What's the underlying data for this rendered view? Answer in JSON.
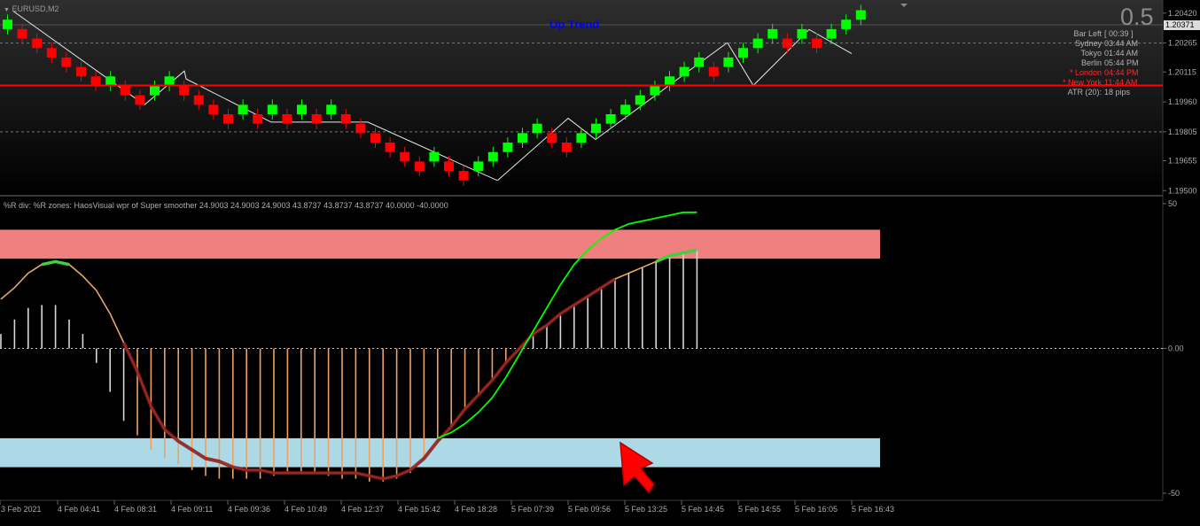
{
  "main_chart": {
    "symbol_title": "EURUSD,M2",
    "trend_label": "Up Trend",
    "top_value": "0.5",
    "current_price": "1.20371",
    "price_axis": [
      "1.20420",
      "1.20265",
      "1.20115",
      "1.19960",
      "1.19805",
      "1.19655",
      "1.19500"
    ],
    "info_panel": [
      {
        "key": "Bar Left",
        "value": "[ 00:39 ]",
        "color": "#b4b4b4"
      },
      {
        "key": "Sydney",
        "value": "03:44 AM",
        "color": "#b4b4b4"
      },
      {
        "key": "Tokyo",
        "value": "01:44 AM",
        "color": "#b4b4b4"
      },
      {
        "key": "Berlin",
        "value": "05:44 PM",
        "color": "#b4b4b4"
      },
      {
        "key": "* London",
        "value": "04:44 PM",
        "color": "#ff2a2a"
      },
      {
        "key": "* New York",
        "value": "11:44 AM",
        "color": "#ff2a2a"
      },
      {
        "key": "ATR (20):",
        "value": "18 pips",
        "color": "#b4b4b4"
      }
    ]
  },
  "indicator": {
    "title": "%R div: %R zones:  HaosVisual wpr of Super smoother 24.9003 24.9003 24.9003 43.8737 43.8737 43.8737 40.0000 -40.0000",
    "axis": [
      "50",
      "0.00",
      "-50"
    ]
  },
  "time_axis": [
    "3 Feb 2021",
    "4 Feb 04:41",
    "4 Feb 08:31",
    "4 Feb 09:11",
    "4 Feb 09:36",
    "4 Feb 10:49",
    "4 Feb 12:37",
    "4 Feb 15:42",
    "4 Feb 18:28",
    "5 Feb 07:39",
    "5 Feb 09:56",
    "5 Feb 13:25",
    "5 Feb 14:45",
    "5 Feb 14:55",
    "5 Feb 16:05",
    "5 Feb 16:43"
  ],
  "colors": {
    "up_brick": "#00ff00",
    "down_brick": "#ff0000",
    "level_line": "#ff0000",
    "upper_zone": "#f08080",
    "lower_zone": "#add8e6",
    "trend_label": "#0000ff"
  },
  "chart_data": [
    {
      "type": "renko",
      "bricks": [
        {
          "c": "up",
          "o": 1.20337,
          "cl": 1.20386
        },
        {
          "c": "down",
          "o": 1.20337,
          "cl": 1.20288
        },
        {
          "c": "down",
          "o": 1.20288,
          "cl": 1.20239
        },
        {
          "c": "down",
          "o": 1.20239,
          "cl": 1.2019
        },
        {
          "c": "down",
          "o": 1.2019,
          "cl": 1.20141
        },
        {
          "c": "down",
          "o": 1.20141,
          "cl": 1.20092
        },
        {
          "c": "down",
          "o": 1.20092,
          "cl": 1.20043
        },
        {
          "c": "up",
          "o": 1.20043,
          "cl": 1.20092
        },
        {
          "c": "down",
          "o": 1.20043,
          "cl": 1.19994
        },
        {
          "c": "down",
          "o": 1.19994,
          "cl": 1.19945
        },
        {
          "c": "up",
          "o": 1.19994,
          "cl": 1.20043
        },
        {
          "c": "up",
          "o": 1.20043,
          "cl": 1.20092
        },
        {
          "c": "down",
          "o": 1.20043,
          "cl": 1.19994
        },
        {
          "c": "down",
          "o": 1.19994,
          "cl": 1.19945
        },
        {
          "c": "down",
          "o": 1.19945,
          "cl": 1.19896
        },
        {
          "c": "down",
          "o": 1.19896,
          "cl": 1.19847
        },
        {
          "c": "up",
          "o": 1.19896,
          "cl": 1.19945
        },
        {
          "c": "down",
          "o": 1.19896,
          "cl": 1.19847
        },
        {
          "c": "up",
          "o": 1.19896,
          "cl": 1.19945
        },
        {
          "c": "down",
          "o": 1.19896,
          "cl": 1.19847
        },
        {
          "c": "up",
          "o": 1.19896,
          "cl": 1.19945
        },
        {
          "c": "down",
          "o": 1.19896,
          "cl": 1.19847
        },
        {
          "c": "up",
          "o": 1.19896,
          "cl": 1.19945
        },
        {
          "c": "down",
          "o": 1.19896,
          "cl": 1.19847
        },
        {
          "c": "down",
          "o": 1.19847,
          "cl": 1.19798
        },
        {
          "c": "down",
          "o": 1.19798,
          "cl": 1.19749
        },
        {
          "c": "down",
          "o": 1.19749,
          "cl": 1.197
        },
        {
          "c": "down",
          "o": 1.197,
          "cl": 1.19651
        },
        {
          "c": "down",
          "o": 1.19651,
          "cl": 1.19602
        },
        {
          "c": "up",
          "o": 1.19651,
          "cl": 1.197
        },
        {
          "c": "down",
          "o": 1.19651,
          "cl": 1.19602
        },
        {
          "c": "down",
          "o": 1.19602,
          "cl": 1.19553
        },
        {
          "c": "up",
          "o": 1.19602,
          "cl": 1.19651
        },
        {
          "c": "up",
          "o": 1.19651,
          "cl": 1.197
        },
        {
          "c": "up",
          "o": 1.197,
          "cl": 1.19749
        },
        {
          "c": "up",
          "o": 1.19749,
          "cl": 1.19798
        },
        {
          "c": "up",
          "o": 1.19798,
          "cl": 1.19847
        },
        {
          "c": "down",
          "o": 1.19798,
          "cl": 1.19749
        },
        {
          "c": "down",
          "o": 1.19749,
          "cl": 1.197
        },
        {
          "c": "up",
          "o": 1.19749,
          "cl": 1.19798
        },
        {
          "c": "up",
          "o": 1.19798,
          "cl": 1.19847
        },
        {
          "c": "up",
          "o": 1.19847,
          "cl": 1.19896
        },
        {
          "c": "up",
          "o": 1.19896,
          "cl": 1.19945
        },
        {
          "c": "up",
          "o": 1.19945,
          "cl": 1.19994
        },
        {
          "c": "up",
          "o": 1.19994,
          "cl": 1.20043
        },
        {
          "c": "up",
          "o": 1.20043,
          "cl": 1.20092
        },
        {
          "c": "up",
          "o": 1.20092,
          "cl": 1.20141
        },
        {
          "c": "up",
          "o": 1.20141,
          "cl": 1.2019
        },
        {
          "c": "down",
          "o": 1.20141,
          "cl": 1.20092
        },
        {
          "c": "up",
          "o": 1.20141,
          "cl": 1.2019
        },
        {
          "c": "up",
          "o": 1.2019,
          "cl": 1.20239
        },
        {
          "c": "up",
          "o": 1.20239,
          "cl": 1.20288
        },
        {
          "c": "up",
          "o": 1.20288,
          "cl": 1.20337
        },
        {
          "c": "down",
          "o": 1.20288,
          "cl": 1.20239
        },
        {
          "c": "up",
          "o": 1.20288,
          "cl": 1.20337
        },
        {
          "c": "down",
          "o": 1.20288,
          "cl": 1.20239
        },
        {
          "c": "up",
          "o": 1.20288,
          "cl": 1.20337
        },
        {
          "c": "up",
          "o": 1.20337,
          "cl": 1.20386
        },
        {
          "c": "up",
          "o": 1.20386,
          "cl": 1.20435
        }
      ],
      "horizontal_level": 1.20045,
      "ylim": [
        1.19483,
        1.20465
      ]
    },
    {
      "type": "line",
      "ylim": [
        -50,
        50
      ],
      "zones": [
        [
          31,
          41
        ],
        [
          -31,
          -41
        ]
      ],
      "histogram": [
        5,
        10,
        14,
        15,
        15,
        10,
        5,
        -5,
        -15,
        -25,
        -30,
        -35,
        -38,
        -40,
        -42,
        -44,
        -45,
        -45,
        -45,
        -45,
        -44,
        -43,
        -43,
        -43,
        -44,
        -45,
        -45,
        -46,
        -46,
        -45,
        -43,
        -38,
        -32,
        -27,
        -21,
        -16,
        -11,
        -5,
        0,
        5,
        8,
        12,
        15,
        18,
        21,
        24,
        26,
        28,
        30,
        32,
        33,
        34
      ],
      "series": [
        {
          "values": [
            17,
            21,
            26,
            29,
            30,
            29,
            25,
            20,
            12,
            2,
            -8,
            -20,
            -28,
            -32,
            -35,
            -38,
            -39,
            -41,
            -42,
            -42,
            -43,
            -43,
            -43,
            -43,
            -43,
            -43,
            -43,
            -44,
            -45,
            -44,
            -42,
            -38,
            -32,
            -27,
            -21,
            -16,
            -11,
            -5,
            0,
            5,
            8,
            12,
            15,
            18,
            21,
            24,
            26,
            28,
            30,
            32,
            33,
            34
          ]
        },
        {
          "values": [
            null,
            null,
            null,
            null,
            null,
            null,
            null,
            null,
            null,
            null,
            null,
            null,
            null,
            null,
            null,
            null,
            null,
            null,
            null,
            null,
            null,
            null,
            null,
            null,
            null,
            null,
            null,
            null,
            null,
            null,
            null,
            null,
            -31,
            -29,
            -26,
            -22,
            -17,
            -10,
            -2,
            6,
            14,
            22,
            29,
            34,
            38,
            41,
            43,
            44,
            45,
            46,
            47,
            47
          ]
        }
      ]
    }
  ]
}
